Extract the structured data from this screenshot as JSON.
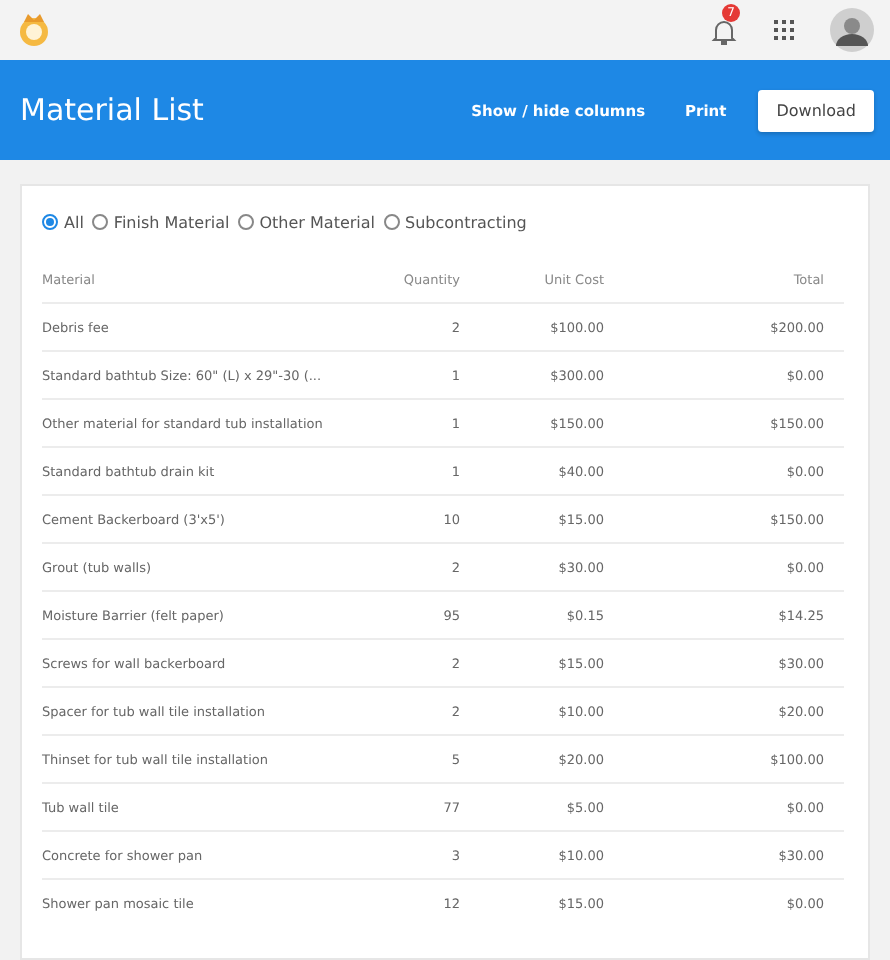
{
  "topbar": {
    "notification_count": "7"
  },
  "header": {
    "title": "Material List",
    "actions": [
      {
        "label": "Show / hide columns",
        "kind": "link"
      },
      {
        "label": "Print",
        "kind": "link"
      },
      {
        "label": "Download",
        "kind": "button"
      }
    ]
  },
  "filters": [
    {
      "label": "All",
      "selected": true
    },
    {
      "label": "Finish Material",
      "selected": false
    },
    {
      "label": "Other Material",
      "selected": false
    },
    {
      "label": "Subcontracting",
      "selected": false
    }
  ],
  "table": {
    "columns": [
      "Material",
      "Quantity",
      "Unit Cost",
      "Total"
    ],
    "rows": [
      [
        "Debris fee",
        "2",
        "$100.00",
        "$200.00"
      ],
      [
        "Standard bathtub Size: 60\" (L) x 29\"-30 (...",
        "1",
        "$300.00",
        "$0.00"
      ],
      [
        "Other material for standard tub installation",
        "1",
        "$150.00",
        "$150.00"
      ],
      [
        "Standard bathtub drain kit",
        "1",
        "$40.00",
        "$0.00"
      ],
      [
        "Cement Backerboard (3'x5')",
        "10",
        "$15.00",
        "$150.00"
      ],
      [
        "Grout (tub walls)",
        "2",
        "$30.00",
        "$0.00"
      ],
      [
        "Moisture Barrier (felt paper)",
        "95",
        "$0.15",
        "$14.25"
      ],
      [
        "Screws for wall backerboard",
        "2",
        "$15.00",
        "$30.00"
      ],
      [
        "Spacer for tub wall tile installation",
        "2",
        "$10.00",
        "$20.00"
      ],
      [
        "Thinset for tub wall tile installation",
        "5",
        "$20.00",
        "$100.00"
      ],
      [
        "Tub wall tile",
        "77",
        "$5.00",
        "$0.00"
      ],
      [
        "Concrete for shower pan",
        "3",
        "$10.00",
        "$30.00"
      ],
      [
        "Shower pan mosaic tile",
        "12",
        "$15.00",
        "$0.00"
      ]
    ]
  }
}
